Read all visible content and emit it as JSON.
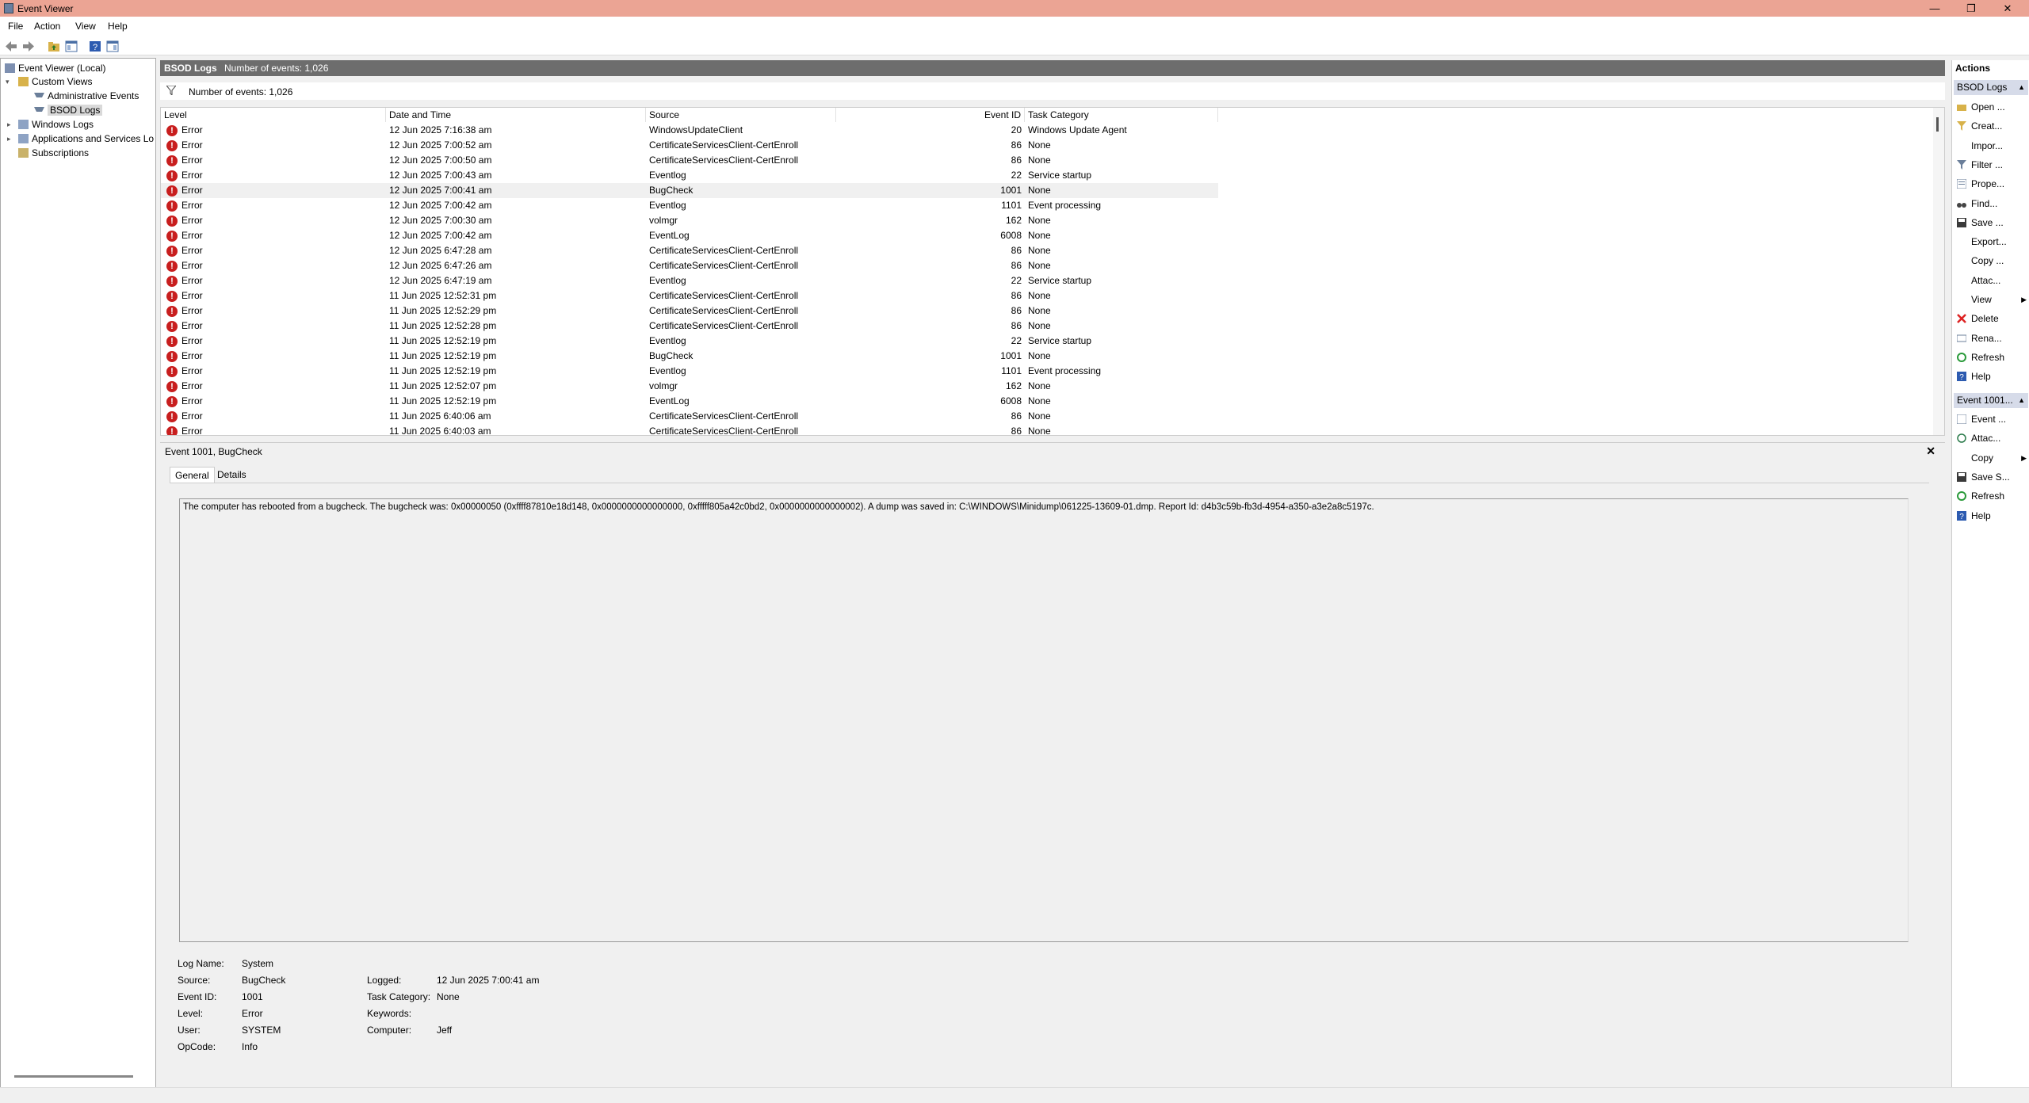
{
  "window": {
    "title": "Event Viewer",
    "minimize": "—",
    "restore": "❐",
    "close": "✕"
  },
  "menu": [
    "File",
    "Action",
    "View",
    "Help"
  ],
  "tree": {
    "root": "Event Viewer (Local)",
    "custom_views": "Custom Views",
    "admin_events": "Administrative Events",
    "bsod_logs": "BSOD Logs",
    "windows_logs": "Windows Logs",
    "app_services": "Applications and Services Lo",
    "subscriptions": "Subscriptions"
  },
  "center": {
    "title": "BSOD Logs",
    "count": "Number of events: 1,026",
    "filter_text": "Number of events: 1,026"
  },
  "columns": {
    "level": "Level",
    "date": "Date and Time",
    "source": "Source",
    "event_id": "Event ID",
    "category": "Task Category"
  },
  "events": [
    {
      "level": "Error",
      "date": "12 Jun 2025 7:16:38 am",
      "source": "WindowsUpdateClient",
      "id": "20",
      "cat": "Windows Update Agent"
    },
    {
      "level": "Error",
      "date": "12 Jun 2025 7:00:52 am",
      "source": "CertificateServicesClient-CertEnroll",
      "id": "86",
      "cat": "None"
    },
    {
      "level": "Error",
      "date": "12 Jun 2025 7:00:50 am",
      "source": "CertificateServicesClient-CertEnroll",
      "id": "86",
      "cat": "None"
    },
    {
      "level": "Error",
      "date": "12 Jun 2025 7:00:43 am",
      "source": "Eventlog",
      "id": "22",
      "cat": "Service startup"
    },
    {
      "level": "Error",
      "date": "12 Jun 2025 7:00:41 am",
      "source": "BugCheck",
      "id": "1001",
      "cat": "None"
    },
    {
      "level": "Error",
      "date": "12 Jun 2025 7:00:42 am",
      "source": "Eventlog",
      "id": "1101",
      "cat": "Event processing"
    },
    {
      "level": "Error",
      "date": "12 Jun 2025 7:00:30 am",
      "source": "volmgr",
      "id": "162",
      "cat": "None"
    },
    {
      "level": "Error",
      "date": "12 Jun 2025 7:00:42 am",
      "source": "EventLog",
      "id": "6008",
      "cat": "None"
    },
    {
      "level": "Error",
      "date": "12 Jun 2025 6:47:28 am",
      "source": "CertificateServicesClient-CertEnroll",
      "id": "86",
      "cat": "None"
    },
    {
      "level": "Error",
      "date": "12 Jun 2025 6:47:26 am",
      "source": "CertificateServicesClient-CertEnroll",
      "id": "86",
      "cat": "None"
    },
    {
      "level": "Error",
      "date": "12 Jun 2025 6:47:19 am",
      "source": "Eventlog",
      "id": "22",
      "cat": "Service startup"
    },
    {
      "level": "Error",
      "date": "11 Jun 2025 12:52:31 pm",
      "source": "CertificateServicesClient-CertEnroll",
      "id": "86",
      "cat": "None"
    },
    {
      "level": "Error",
      "date": "11 Jun 2025 12:52:29 pm",
      "source": "CertificateServicesClient-CertEnroll",
      "id": "86",
      "cat": "None"
    },
    {
      "level": "Error",
      "date": "11 Jun 2025 12:52:28 pm",
      "source": "CertificateServicesClient-CertEnroll",
      "id": "86",
      "cat": "None"
    },
    {
      "level": "Error",
      "date": "11 Jun 2025 12:52:19 pm",
      "source": "Eventlog",
      "id": "22",
      "cat": "Service startup"
    },
    {
      "level": "Error",
      "date": "11 Jun 2025 12:52:19 pm",
      "source": "BugCheck",
      "id": "1001",
      "cat": "None"
    },
    {
      "level": "Error",
      "date": "11 Jun 2025 12:52:19 pm",
      "source": "Eventlog",
      "id": "1101",
      "cat": "Event processing"
    },
    {
      "level": "Error",
      "date": "11 Jun 2025 12:52:07 pm",
      "source": "volmgr",
      "id": "162",
      "cat": "None"
    },
    {
      "level": "Error",
      "date": "11 Jun 2025 12:52:19 pm",
      "source": "EventLog",
      "id": "6008",
      "cat": "None"
    },
    {
      "level": "Error",
      "date": "11 Jun 2025 6:40:06 am",
      "source": "CertificateServicesClient-CertEnroll",
      "id": "86",
      "cat": "None"
    },
    {
      "level": "Error",
      "date": "11 Jun 2025 6:40:03 am",
      "source": "CertificateServicesClient-CertEnroll",
      "id": "86",
      "cat": "None"
    }
  ],
  "selected_row_index": 4,
  "detail": {
    "title": "Event 1001, BugCheck",
    "close": "✕",
    "tab_general": "General",
    "tab_details": "Details",
    "message": "The computer has rebooted from a bugcheck.  The bugcheck was: 0x00000050 (0xffff87810e18d148, 0x0000000000000000, 0xfffff805a42c0bd2, 0x0000000000000002). A dump was saved in: C:\\WINDOWS\\Minidump\\061225-13609-01.dmp. Report Id: d4b3c59b-fb3d-4954-a350-a3e2a8c5197c.",
    "labels": {
      "log_name": "Log Name:",
      "source": "Source:",
      "event_id": "Event ID:",
      "level": "Level:",
      "user": "User:",
      "opcode": "OpCode:",
      "logged": "Logged:",
      "task_category": "Task Category:",
      "keywords": "Keywords:",
      "computer": "Computer:"
    },
    "values": {
      "log_name": "System",
      "source": "BugCheck",
      "event_id": "1001",
      "level": "Error",
      "user": "SYSTEM",
      "opcode": "Info",
      "logged": "12 Jun 2025 7:00:41 am",
      "task_category": "None",
      "keywords": "",
      "computer": "Jeff"
    }
  },
  "actions": {
    "title": "Actions",
    "group1": "BSOD Logs",
    "group1_items": [
      {
        "label": "Open ...",
        "icon": "folder-open-icon"
      },
      {
        "label": "Creat...",
        "icon": "filter-create-icon"
      },
      {
        "label": "Impor...",
        "icon": "blank-icon"
      },
      {
        "label": "Filter ...",
        "icon": "filter-icon"
      },
      {
        "label": "Prope...",
        "icon": "properties-icon"
      },
      {
        "label": "Find...",
        "icon": "binoculars-icon"
      },
      {
        "label": "Save ...",
        "icon": "save-icon"
      },
      {
        "label": "Export...",
        "icon": "blank-icon"
      },
      {
        "label": "Copy ...",
        "icon": "blank-icon"
      },
      {
        "label": "Attac...",
        "icon": "blank-icon"
      },
      {
        "label": "View",
        "icon": "blank-icon",
        "submenu": true
      },
      {
        "label": "Delete",
        "icon": "delete-icon"
      },
      {
        "label": "Rena...",
        "icon": "rename-icon"
      },
      {
        "label": "Refresh",
        "icon": "refresh-icon"
      },
      {
        "label": "Help",
        "icon": "help-icon"
      }
    ],
    "group2": "Event 1001...",
    "group2_items": [
      {
        "label": "Event ...",
        "icon": "event-properties-icon"
      },
      {
        "label": "Attac...",
        "icon": "attach-task-icon"
      },
      {
        "label": "Copy",
        "icon": "blank-icon",
        "submenu": true
      },
      {
        "label": "Save S...",
        "icon": "save-icon"
      },
      {
        "label": "Refresh",
        "icon": "refresh-icon"
      },
      {
        "label": "Help",
        "icon": "help-icon"
      }
    ]
  },
  "colors": {
    "titlebar": "#eba494",
    "error": "#c81e1e",
    "group_header": "#d6dbe9",
    "pane_header": "#6d6d6d"
  }
}
